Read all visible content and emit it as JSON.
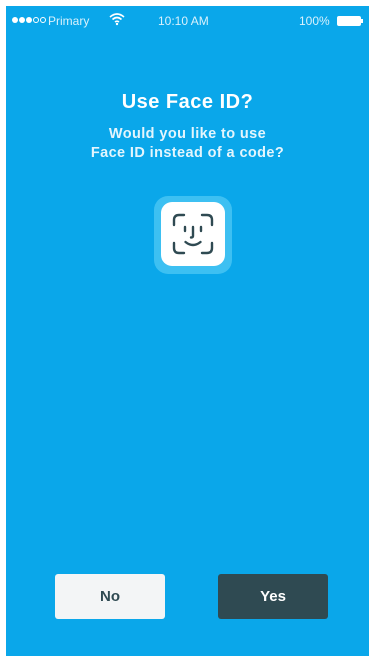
{
  "status_bar": {
    "carrier": "Primary",
    "time": "10:10 AM",
    "battery": "100%"
  },
  "prompt": {
    "title": "Use Face ID?",
    "subtitle_line1": "Would you like to use",
    "subtitle_line2": "Face ID instead of a code?"
  },
  "icon": "face-id-icon",
  "buttons": {
    "no_label": "No",
    "yes_label": "Yes"
  },
  "colors": {
    "background": "#0aa7ea",
    "yes_button": "#2f4a52",
    "no_button": "#f3f5f6"
  }
}
